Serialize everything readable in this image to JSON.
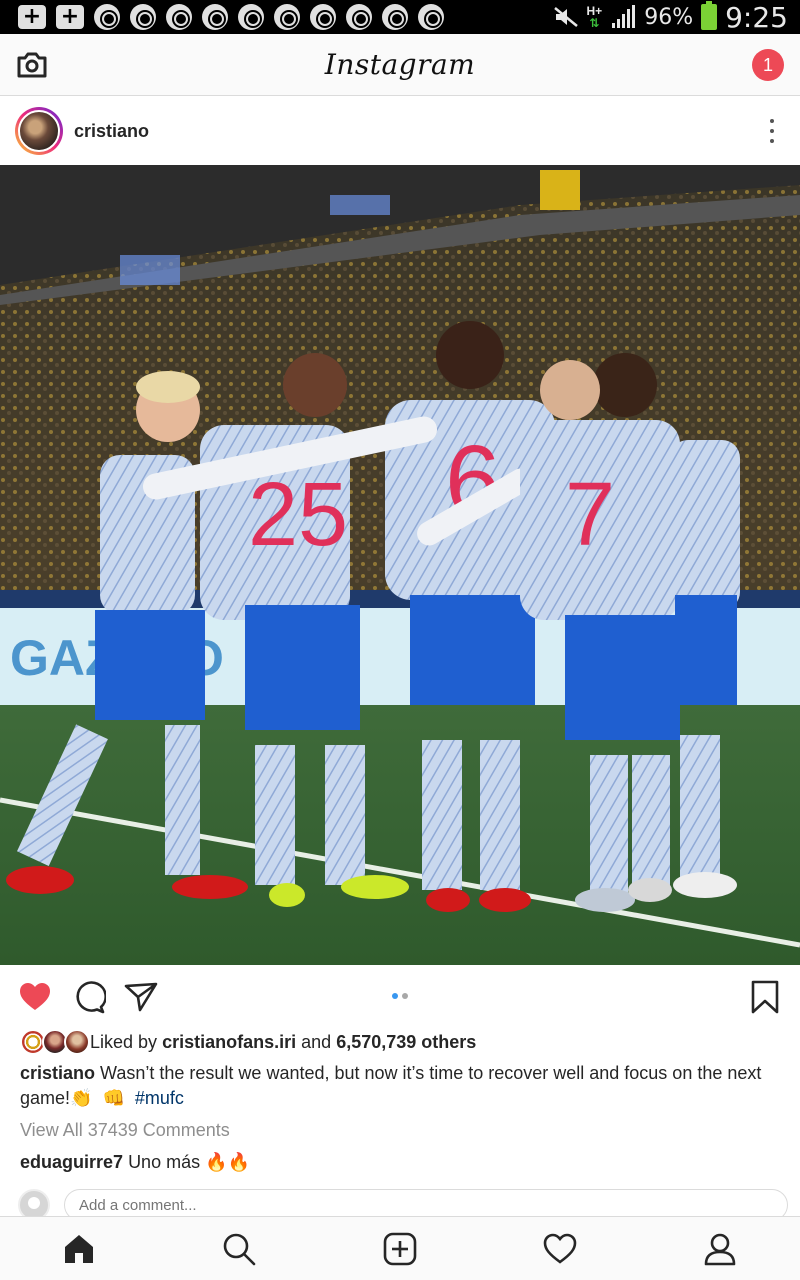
{
  "status_bar": {
    "battery_percent": "96%",
    "time": "9:25",
    "network": "H+",
    "left_icons": [
      "plus-box-icon",
      "plus-box-icon",
      "chrome-icon",
      "chrome-icon",
      "chrome-icon",
      "chrome-icon",
      "chrome-icon",
      "chrome-icon",
      "chrome-icon",
      "chrome-icon",
      "chrome-icon",
      "chrome-icon"
    ]
  },
  "header": {
    "logo_text": "Instagram",
    "notification_count": "1"
  },
  "post": {
    "username": "cristiano",
    "image_description_icon": "photo",
    "carousel": {
      "count": 2,
      "active": 0,
      "active_color": "#3897f0",
      "inactive_color": "#a8a8a8"
    },
    "liked": true,
    "like_color": "#ed4956",
    "liked_by_prefix": "Liked by",
    "liked_by_user": "cristianofans.iri",
    "liked_by_and": "and",
    "likes_others": "6,570,739 others",
    "caption_user": "cristiano",
    "caption_text": "Wasn’t the result we wanted, but now it’s time to recover well and focus on the next game!",
    "caption_hashtag": "#mufc",
    "view_all_comments": "View All 37439 Comments",
    "comment_user": "eduaguirre7",
    "comment_text": "Uno más",
    "add_comment_placeholder": "Add a comment..."
  },
  "nav": {
    "items": [
      "home-icon",
      "search-icon",
      "add-post-icon",
      "activity-heart-icon",
      "profile-icon"
    ]
  }
}
